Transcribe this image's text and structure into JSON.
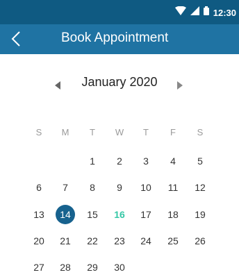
{
  "status": {
    "time": "12:30"
  },
  "app_bar": {
    "title": "Book Appointment"
  },
  "calendar": {
    "month_label": "January 2020",
    "weekdays": [
      "S",
      "M",
      "T",
      "W",
      "T",
      "F",
      "S"
    ],
    "selected_day": 14,
    "today": 16,
    "weeks": [
      [
        "",
        "",
        "1",
        "2",
        "3",
        "4",
        "5"
      ],
      [
        "6",
        "7",
        "8",
        "9",
        "10",
        "11",
        "12"
      ],
      [
        "13",
        "14",
        "15",
        "16",
        "17",
        "18",
        "19"
      ],
      [
        "20",
        "21",
        "22",
        "23",
        "24",
        "25",
        "26"
      ],
      [
        "27",
        "28",
        "29",
        "30",
        "",
        "",
        ""
      ]
    ]
  },
  "colors": {
    "status_bar": "#0f5a82",
    "app_bar": "#1f73a3",
    "selected": "#17628e",
    "today": "#35c7a6"
  }
}
